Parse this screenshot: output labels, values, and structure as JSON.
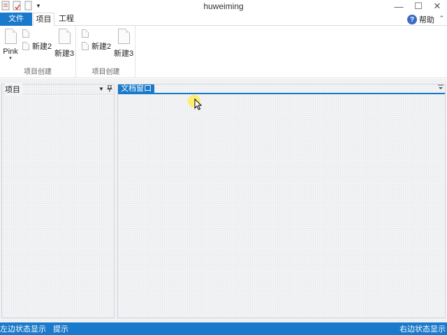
{
  "window": {
    "title": "huweiming",
    "minimize": "—",
    "maximize": "☐",
    "close": "✕"
  },
  "quick_access": {
    "icons": [
      "app-logo-icon",
      "save-icon",
      "new-document-icon"
    ],
    "customize": "▼"
  },
  "tabs": [
    {
      "label": "文件",
      "active": false,
      "highlight": true
    },
    {
      "label": "项目",
      "active": true
    },
    {
      "label": "工程",
      "active": false
    }
  ],
  "help": {
    "icon": "?",
    "label": "帮助"
  },
  "ribbon_collapse": "⌃",
  "ribbon": {
    "groups": [
      {
        "label": "项目创建",
        "buttons": [
          {
            "label": "Pink",
            "dropdown": "▼",
            "icon": "document-icon"
          },
          {
            "label": "",
            "icon": "document-icon"
          },
          {
            "label": "新建2",
            "icon": "document-icon"
          },
          {
            "label": "新建3",
            "icon": "document-icon"
          }
        ]
      },
      {
        "label": "项目创建",
        "buttons": [
          {
            "label": "",
            "icon": "document-icon"
          },
          {
            "label": "新建2",
            "icon": "document-icon"
          },
          {
            "label": "新建3",
            "icon": "document-icon"
          }
        ]
      }
    ]
  },
  "left_panel": {
    "title": "项目",
    "dropdown": "▼",
    "pin": "📌"
  },
  "document_area": {
    "tab": "文档窗口",
    "menu": "▼"
  },
  "statusbar": {
    "left": "左边状态显示",
    "hint": "提示",
    "right": "右边状态显示"
  },
  "colors": {
    "accent": "#1979ca",
    "workspace_bg": "#f2f3f5",
    "cursor_highlight": "#ffec5a"
  }
}
